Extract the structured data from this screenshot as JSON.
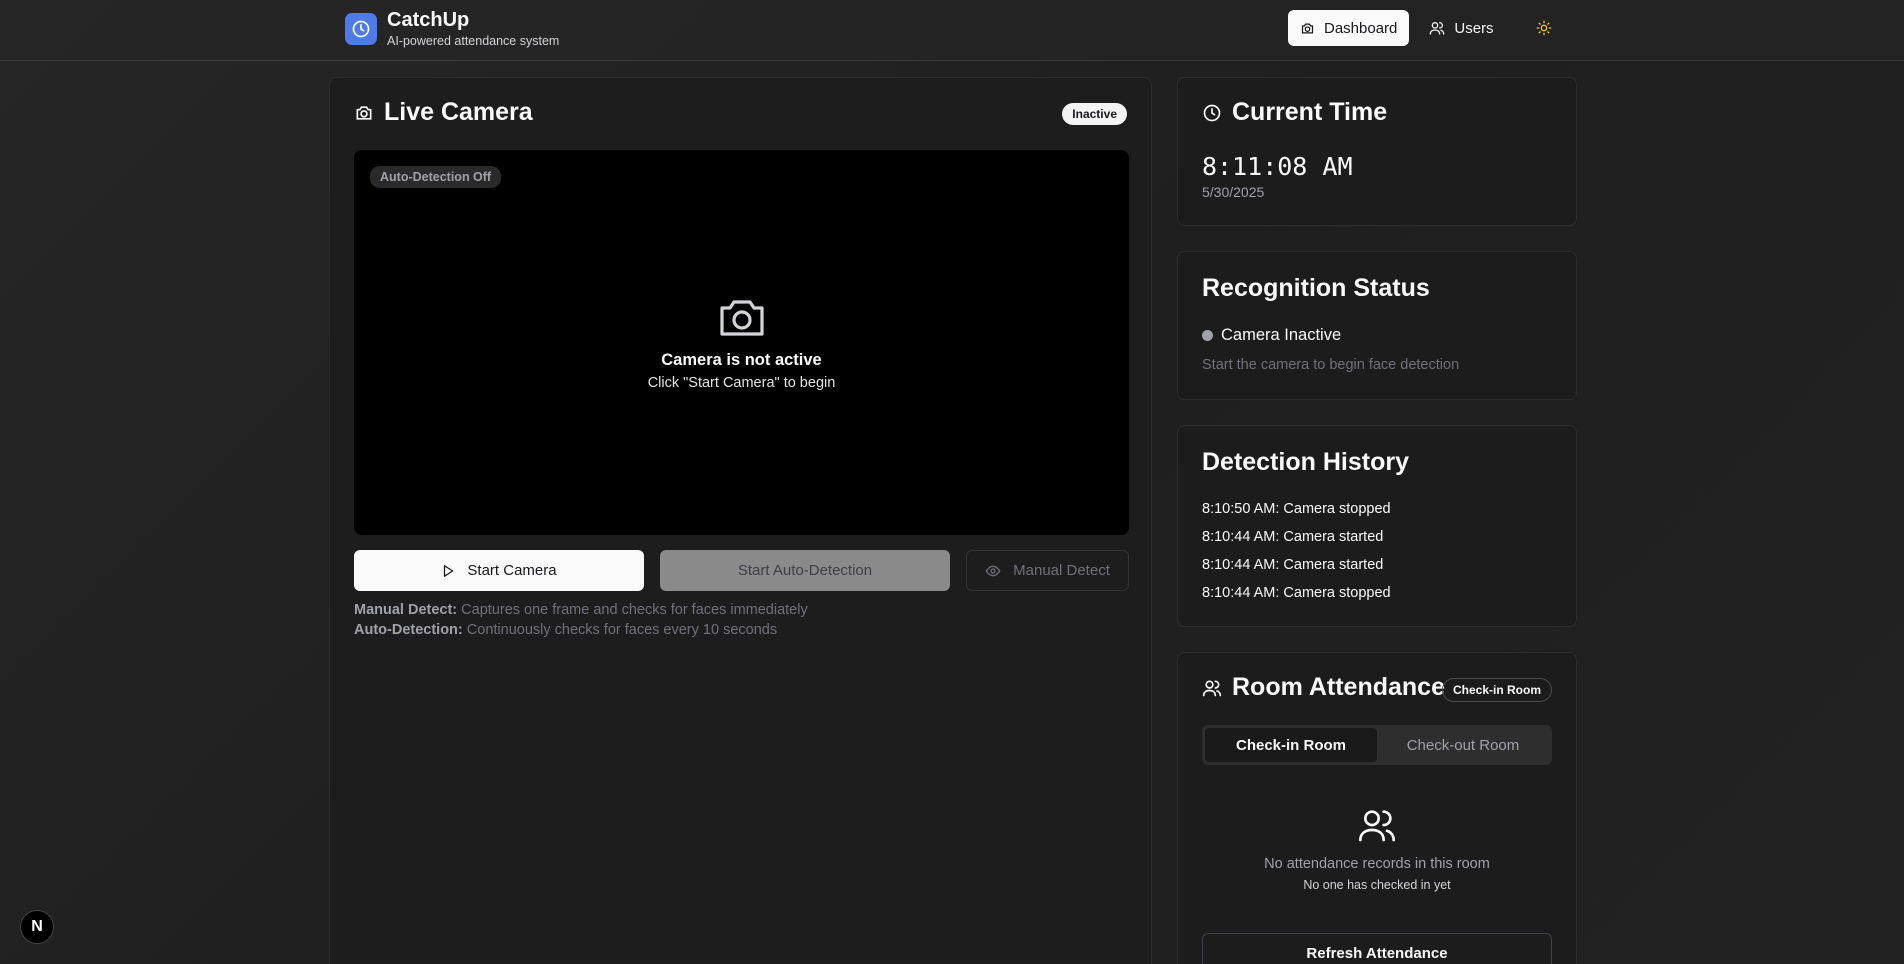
{
  "header": {
    "title": "CatchUp",
    "subtitle": "AI-powered attendance system",
    "nav": {
      "dashboard": "Dashboard",
      "users": "Users"
    }
  },
  "camera": {
    "title": "Live Camera",
    "status_badge": "Inactive",
    "auto_detection_badge": "Auto-Detection Off",
    "empty_title": "Camera is not active",
    "empty_hint": "Click \"Start Camera\" to begin",
    "buttons": {
      "start_camera": "Start Camera",
      "start_auto": "Start Auto-Detection",
      "manual_detect": "Manual Detect"
    },
    "help": {
      "manual_label": "Manual Detect:",
      "manual_text": " Captures one frame and checks for faces immediately",
      "auto_label": "Auto-Detection:",
      "auto_text": " Continuously checks for faces every 10 seconds"
    }
  },
  "current_time": {
    "title": "Current Time",
    "time": "8:11:08 AM",
    "date": "5/30/2025"
  },
  "recognition": {
    "title": "Recognition Status",
    "status": "Camera Inactive",
    "hint": "Start the camera to begin face detection"
  },
  "history": {
    "title": "Detection History",
    "items": [
      "8:10:50 AM: Camera stopped",
      "8:10:44 AM: Camera started",
      "8:10:44 AM: Camera started",
      "8:10:44 AM: Camera stopped"
    ]
  },
  "attendance": {
    "title": "Room Attendance",
    "badge": "Check-in Room",
    "tabs": [
      "Check-in Room",
      "Check-out Room"
    ],
    "empty_title": "No attendance records in this room",
    "empty_hint": "No one has checked in yet",
    "refresh": "Refresh Attendance"
  },
  "colors": {
    "accent": "#4f7be8",
    "sun": "#f5c542"
  },
  "dev_badge": "N"
}
